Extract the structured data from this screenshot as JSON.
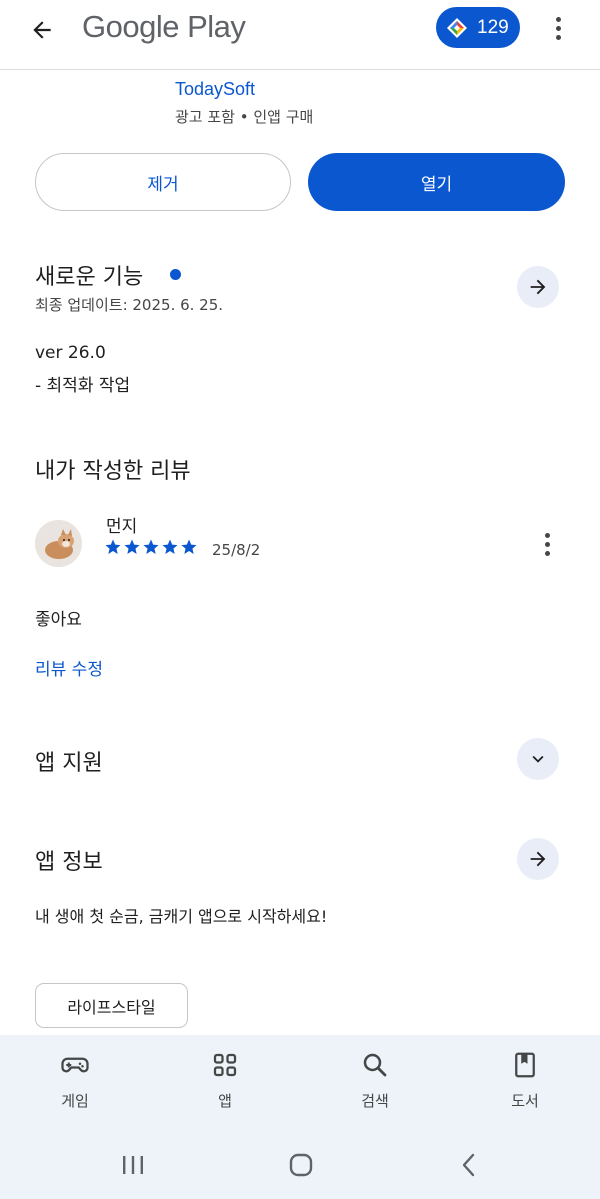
{
  "header": {
    "title": "Google Play",
    "points_value": "129",
    "back_icon": "arrow-back-icon",
    "more_icon": "more-vert-icon",
    "points_icon": "play-points-icon"
  },
  "app": {
    "developer": "TodaySoft",
    "meta": "광고 포함 • 인앱 구매"
  },
  "actions": {
    "uninstall_label": "제거",
    "open_label": "열기"
  },
  "whats_new": {
    "title": "새로운 기능",
    "updated": "최종 업데이트: 2025. 6. 25.",
    "version": "ver 26.0",
    "notes": "- 최적화 작업"
  },
  "my_review": {
    "section_title": "내가 작성한 리뷰",
    "reviewer": "먼지",
    "rating": 5,
    "date": "25/8/2",
    "text": "좋아요",
    "edit_label": "리뷰 수정"
  },
  "app_support": {
    "title": "앱 지원"
  },
  "about_app": {
    "title": "앱 정보",
    "description": "내 생애 첫 순금, 금캐기 앱으로 시작하세요!",
    "category_chip": "라이프스타일"
  },
  "bottom_nav": {
    "items": [
      {
        "label": "게임",
        "icon": "gamepad-icon"
      },
      {
        "label": "앱",
        "icon": "apps-grid-icon"
      },
      {
        "label": "검색",
        "icon": "search-icon"
      },
      {
        "label": "도서",
        "icon": "book-icon"
      }
    ]
  },
  "colors": {
    "accent": "#0b57d0",
    "text": "#1f1f1f",
    "secondary_text": "#444746",
    "nav_bg": "#eef2f9",
    "round_button_bg": "#e8edf7"
  }
}
